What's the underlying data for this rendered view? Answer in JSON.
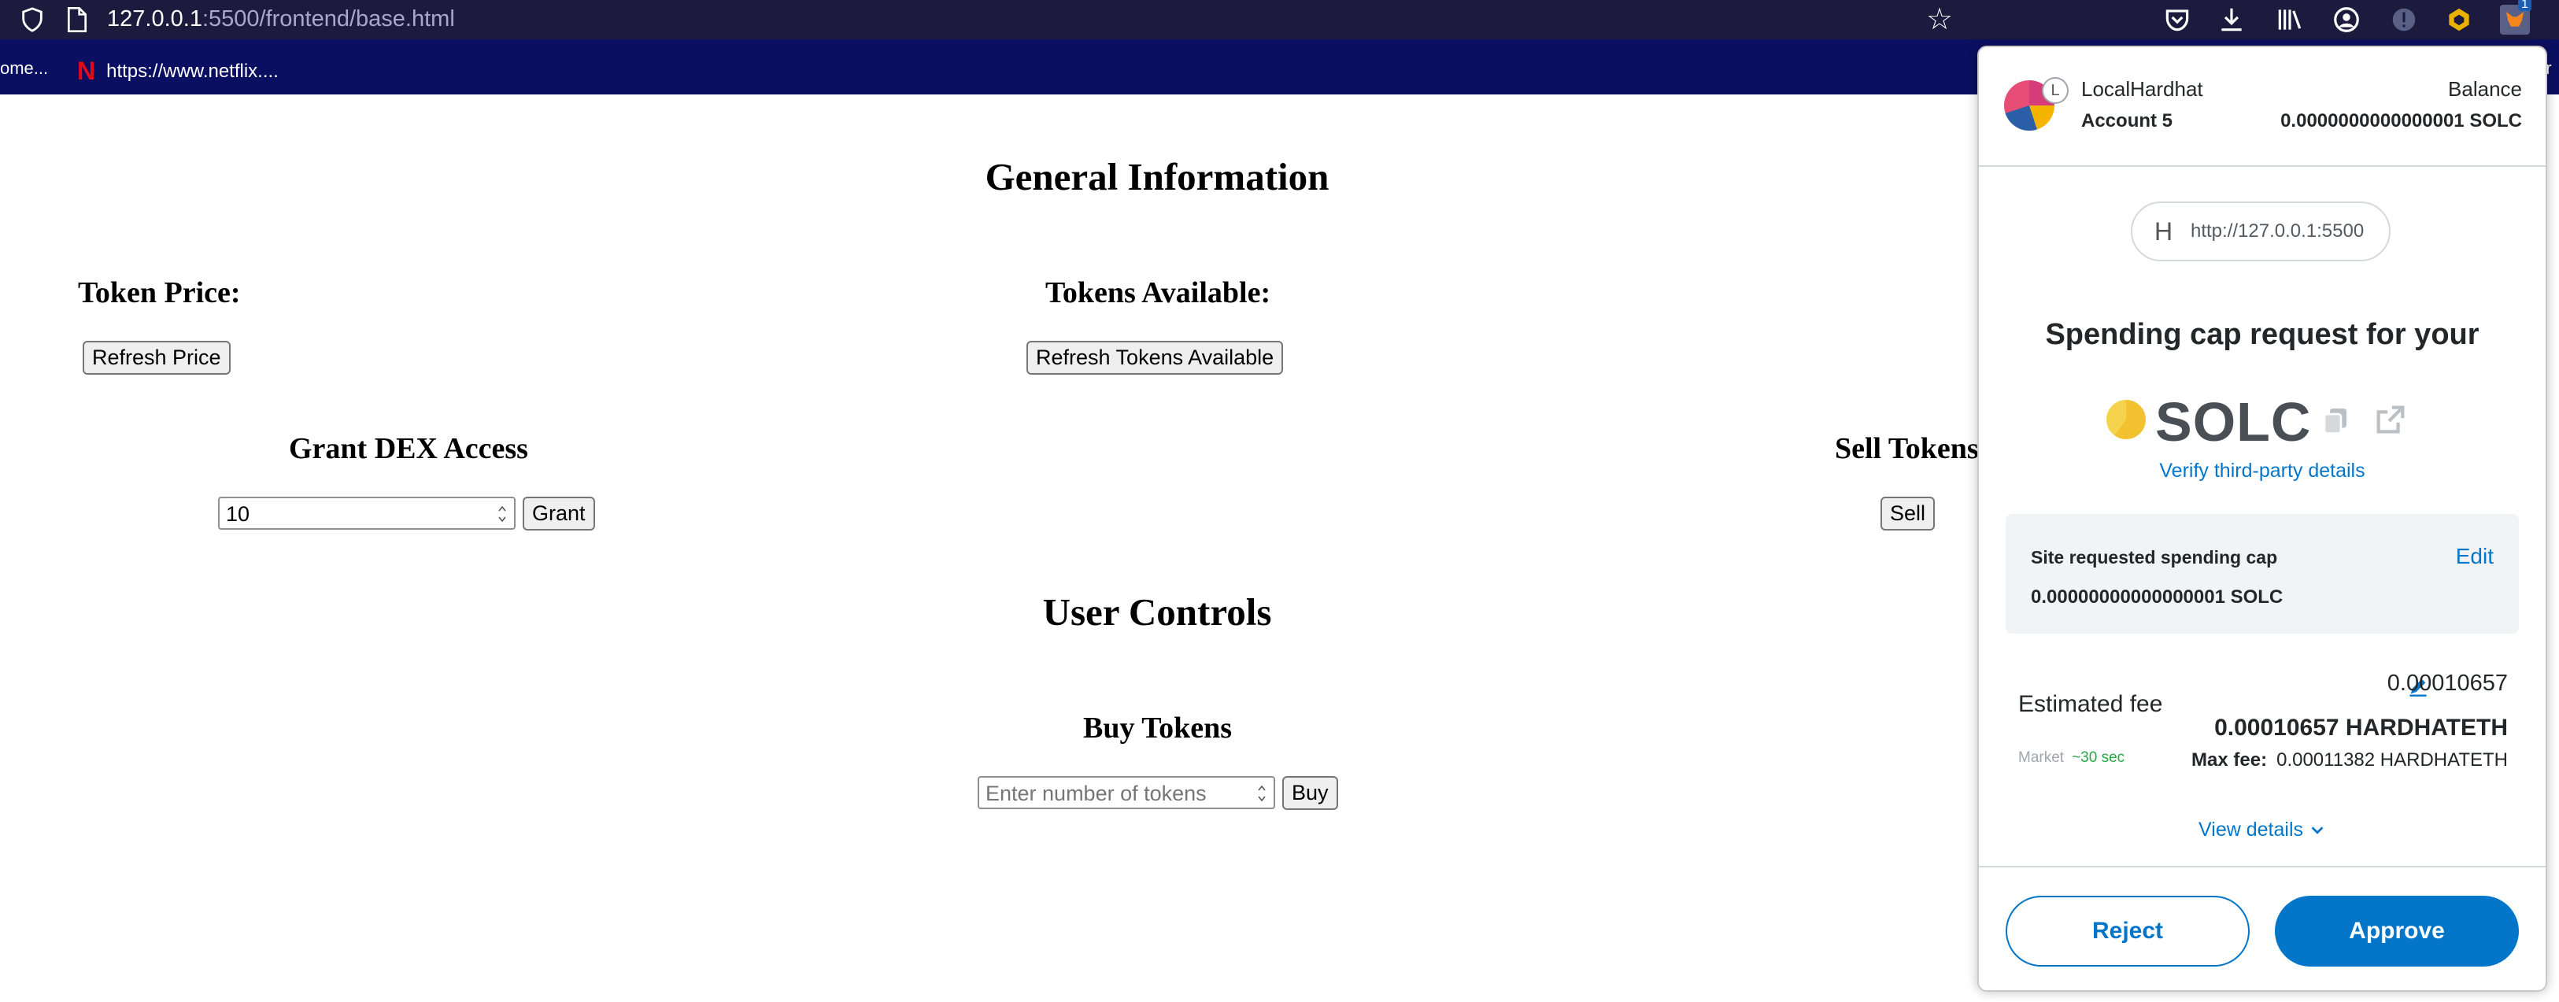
{
  "browser": {
    "url_host": "127.0.0.1",
    "url_path": ":5500/frontend/base.html",
    "bookmarks": [
      {
        "label": "ome..."
      },
      {
        "label": "https://www.netflix...."
      },
      {
        "label": "er"
      }
    ],
    "extension_badge": "1",
    "netflix_glyph": "N",
    "icons": [
      "shield-icon",
      "page-icon",
      "bookmark-star-icon",
      "pocket-icon",
      "download-icon",
      "library-icon",
      "account-icon",
      "privacy-icon",
      "extension-icon",
      "metamask-fox-icon"
    ]
  },
  "page": {
    "general_heading": "General Information",
    "token_price_heading": "Token Price:",
    "refresh_price_label": "Refresh Price",
    "tokens_available_heading": "Tokens Available:",
    "refresh_tokens_label": "Refresh Tokens Available",
    "grant_heading": "Grant DEX Access",
    "grant_input_value": "10",
    "grant_button_label": "Grant",
    "sell_heading": "Sell Tokens",
    "sell_button_label": "Sell",
    "user_controls_heading": "User Controls",
    "buy_heading": "Buy Tokens",
    "buy_input_placeholder": "Enter number of tokens",
    "buy_button_label": "Buy"
  },
  "metamask": {
    "network_name": "LocalHardhat",
    "network_badge": "L",
    "account_name": "Account 5",
    "balance_label": "Balance",
    "balance_value": "0.0000000000000001 SOLC",
    "origin_icon": "H",
    "origin_url": "http://127.0.0.1:5500",
    "title": "Spending cap request for your",
    "token_symbol": "SOLC",
    "verify_link": "Verify third-party details",
    "cap_label": "Site requested spending cap",
    "cap_value": "0.00000000000000001 SOLC",
    "edit_label": "Edit",
    "fee_amount_top": "0.00010657",
    "fee_label": "Estimated fee",
    "fee_main": "0.00010657 HARDHATETH",
    "market_label": "Market",
    "market_time": "~30 sec",
    "max_fee_label": "Max fee:",
    "max_fee_value": "0.00011382 HARDHATETH",
    "view_details": "View details",
    "reject_label": "Reject",
    "approve_label": "Approve",
    "colors": {
      "accent": "#0376c9",
      "market_green": "#28a745"
    }
  }
}
